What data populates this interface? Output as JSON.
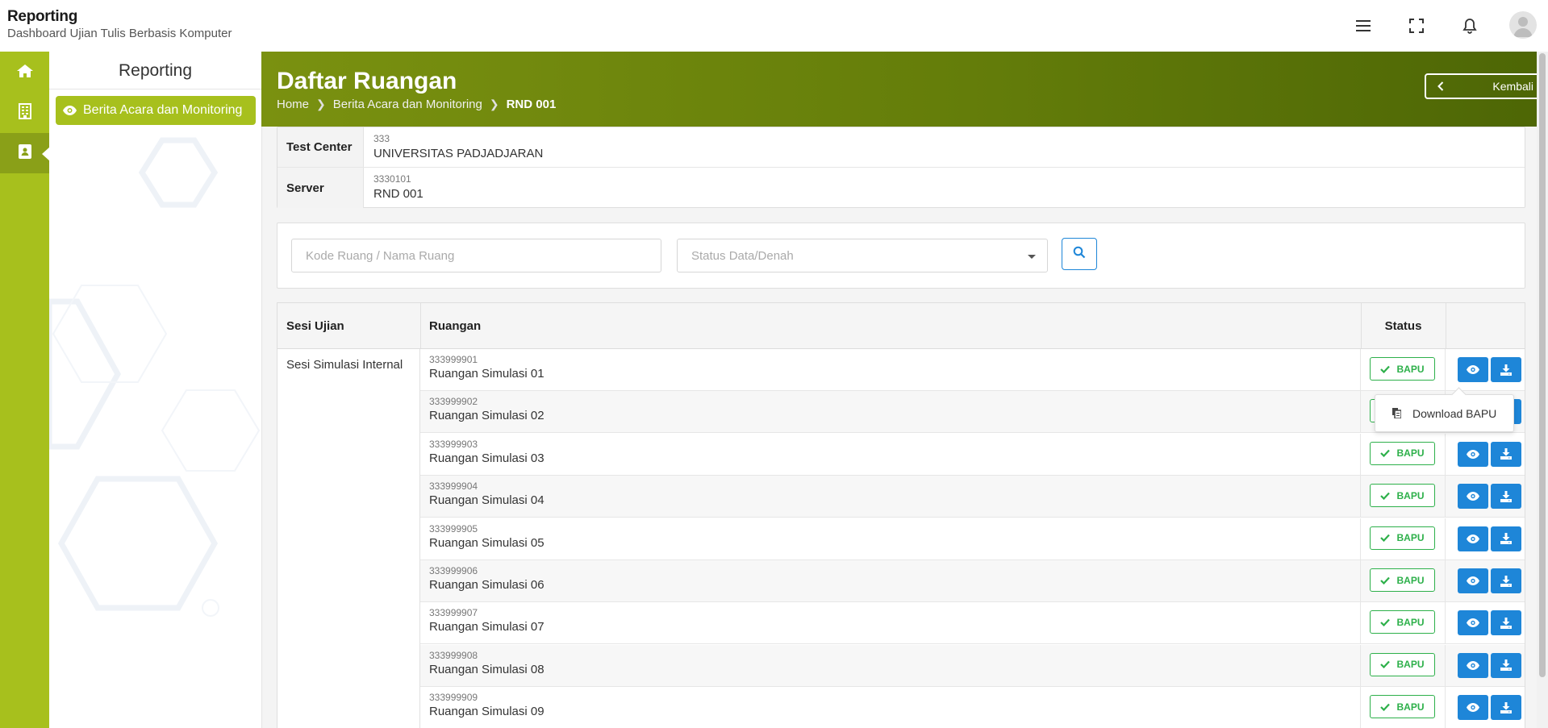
{
  "app": {
    "title": "Reporting",
    "subtitle": "Dashboard Ujian Tulis Berbasis Komputer"
  },
  "topbar": {
    "icons": [
      "menu-icon",
      "fullscreen-icon",
      "bell-icon",
      "user-avatar-icon"
    ]
  },
  "rail": {
    "items": [
      "home-icon",
      "building-icon",
      "report-icon"
    ],
    "active_index": 2
  },
  "sidebar": {
    "title": "Reporting",
    "items": [
      {
        "label": "Berita Acara dan Monitoring",
        "icon": "eye-icon"
      }
    ]
  },
  "header": {
    "title": "Daftar Ruangan",
    "breadcrumb": [
      "Home",
      "Berita Acara dan Monitoring",
      "RND 001"
    ],
    "back_label": "Kembali"
  },
  "info": {
    "test_center": {
      "label": "Test Center",
      "code": "333",
      "value": "UNIVERSITAS PADJADJARAN"
    },
    "server": {
      "label": "Server",
      "code": "3330101",
      "value": "RND 001"
    }
  },
  "filter": {
    "search_placeholder": "Kode Ruang / Nama Ruang",
    "status_placeholder": "Status Data/Denah"
  },
  "table": {
    "headers": {
      "sesi": "Sesi Ujian",
      "ruangan": "Ruangan",
      "status": "Status"
    },
    "session": "Sesi Simulasi Internal",
    "rows": [
      {
        "code": "333999901",
        "name": "Ruangan Simulasi 01",
        "status": "BAPU"
      },
      {
        "code": "333999902",
        "name": "Ruangan Simulasi 02",
        "status": "BAPU"
      },
      {
        "code": "333999903",
        "name": "Ruangan Simulasi 03",
        "status": "BAPU"
      },
      {
        "code": "333999904",
        "name": "Ruangan Simulasi 04",
        "status": "BAPU"
      },
      {
        "code": "333999905",
        "name": "Ruangan Simulasi 05",
        "status": "BAPU"
      },
      {
        "code": "333999906",
        "name": "Ruangan Simulasi 06",
        "status": "BAPU"
      },
      {
        "code": "333999907",
        "name": "Ruangan Simulasi 07",
        "status": "BAPU"
      },
      {
        "code": "333999908",
        "name": "Ruangan Simulasi 08",
        "status": "BAPU"
      },
      {
        "code": "333999909",
        "name": "Ruangan Simulasi 09",
        "status": "BAPU"
      }
    ]
  },
  "dropdown": {
    "item": "Download BAPU"
  },
  "colors": {
    "accent": "#a7c01d",
    "primary": "#1e86d8",
    "success": "#2db04a",
    "banner_dark": "#4d6605"
  }
}
